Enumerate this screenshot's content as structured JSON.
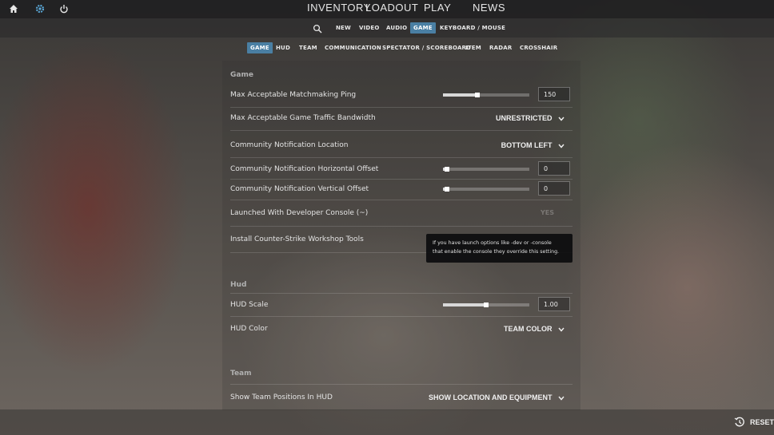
{
  "topnav": {
    "items": [
      "INVENTORY",
      "LOADOUT",
      "PLAY",
      "NEWS"
    ],
    "icons": [
      "home-icon",
      "gear-icon",
      "power-icon"
    ]
  },
  "subnav": {
    "tabs": [
      "NEW",
      "VIDEO",
      "AUDIO",
      "GAME",
      "KEYBOARD / MOUSE"
    ],
    "active": "GAME"
  },
  "categories": {
    "tabs": [
      "GAME",
      "HUD",
      "TEAM",
      "COMMUNICATION",
      "SPECTATOR / SCOREBOARD",
      "ITEM",
      "RADAR",
      "CROSSHAIR"
    ],
    "active": "GAME"
  },
  "sections": {
    "game": {
      "title": "Game",
      "max_ping": {
        "label": "Max Acceptable Matchmaking Ping",
        "value": "150",
        "level": 0.4
      },
      "traffic_bandwidth": {
        "label": "Max Acceptable Game Traffic Bandwidth",
        "value": "UNRESTRICTED"
      },
      "notif_location": {
        "label": "Community Notification Location",
        "value": "BOTTOM LEFT"
      },
      "notif_h_offset": {
        "label": "Community Notification Horizontal Offset",
        "value": "0",
        "level": 0.05
      },
      "notif_v_offset": {
        "label": "Community Notification Vertical Offset",
        "value": "0",
        "level": 0.05
      },
      "dev_console": {
        "label": "Launched With Developer Console (~)",
        "value": "YES"
      },
      "workshop_tools": {
        "label": "Install Counter-Strike Workshop Tools"
      }
    },
    "hud": {
      "title": "Hud",
      "hud_scale": {
        "label": "HUD Scale",
        "value": "1.00",
        "level": 0.5
      },
      "hud_color": {
        "label": "HUD Color",
        "value": "TEAM COLOR"
      }
    },
    "team": {
      "title": "Team",
      "team_positions": {
        "label": "Show Team Positions In HUD",
        "value": "SHOW LOCATION AND EQUIPMENT"
      }
    }
  },
  "tooltip": {
    "line1": "If you have launch options like -dev or -console",
    "line2": "that enable the console they override this setting."
  },
  "footer": {
    "reset_label": "RESET"
  },
  "colors": {
    "accent": "#4a7fa3",
    "tooltip_bg": "#0c0c0e"
  }
}
